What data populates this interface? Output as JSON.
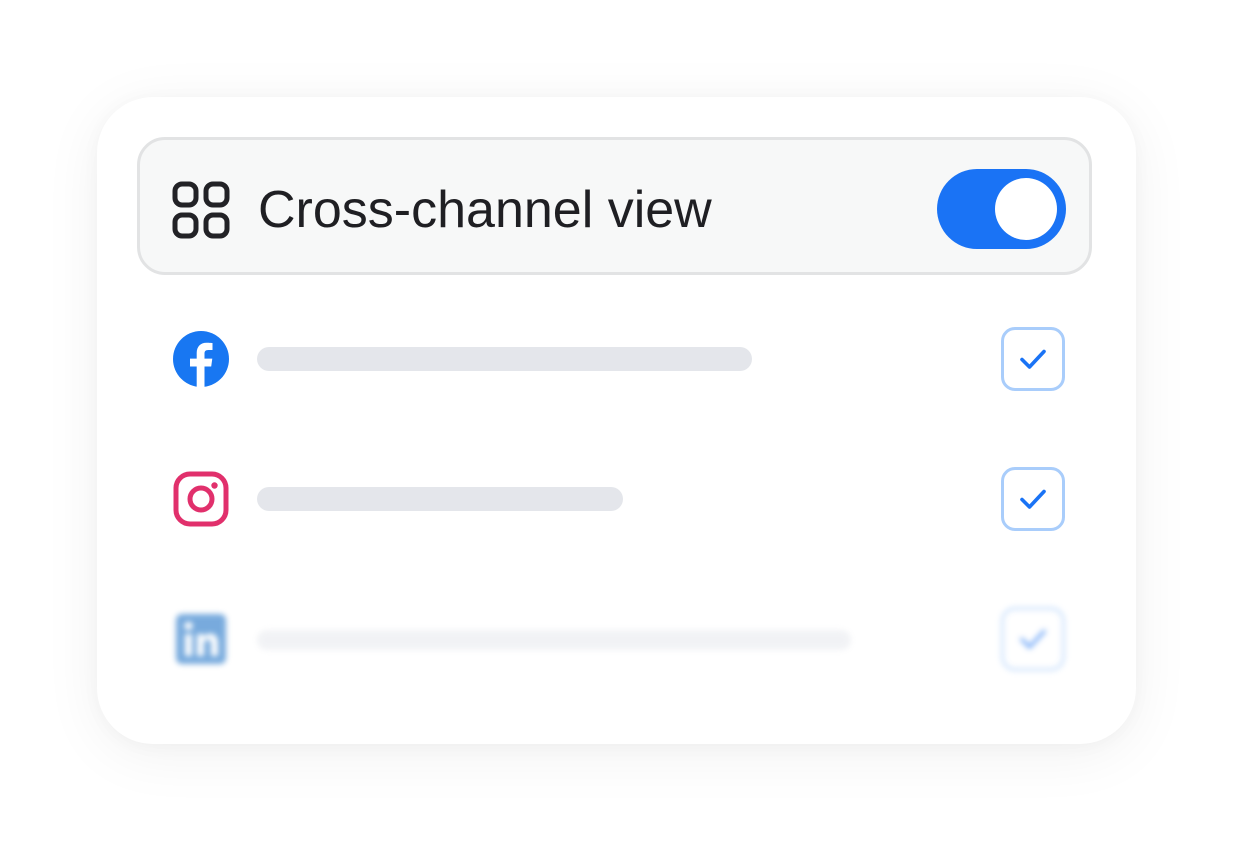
{
  "panel": {
    "header": {
      "icon": "grid-icon",
      "title": "Cross-channel view",
      "toggle_on": true,
      "accent_color": "#1a73f5"
    },
    "channels": [
      {
        "icon": "facebook-icon",
        "icon_color": "#1877f2",
        "checked": true
      },
      {
        "icon": "instagram-icon",
        "icon_color": "#e1306c",
        "checked": true
      },
      {
        "icon": "linkedin-icon",
        "icon_color": "#0a66c2",
        "checked": true,
        "blurred": true
      }
    ]
  }
}
